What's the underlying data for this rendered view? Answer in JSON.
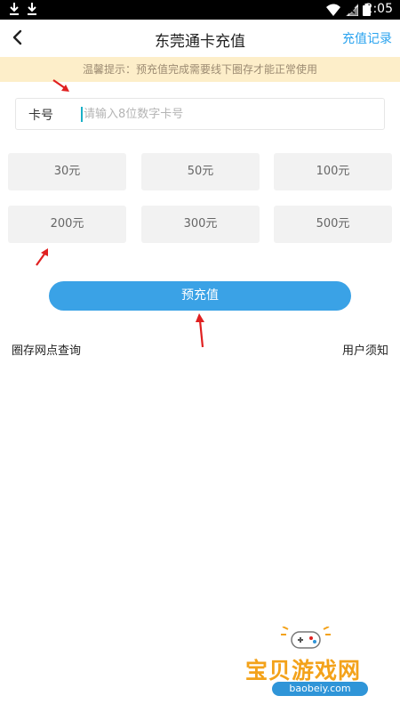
{
  "status_bar": {
    "time": "2:05"
  },
  "header": {
    "title": "东莞通卡充值",
    "records_link": "充值记录"
  },
  "notice": {
    "text": "温馨提示：预充值完成需要线下圈存才能正常使用"
  },
  "card_input": {
    "label": "卡号",
    "placeholder": "请输入8位数字卡号",
    "value": ""
  },
  "amounts": [
    {
      "label": "30元"
    },
    {
      "label": "50元"
    },
    {
      "label": "100元"
    },
    {
      "label": "200元"
    },
    {
      "label": "300元"
    },
    {
      "label": "500元"
    }
  ],
  "submit_button": {
    "label": "预充值"
  },
  "footer_links": {
    "left": "圈存网点查询",
    "right": "用户须知"
  },
  "watermark": {
    "text": "宝贝游戏网",
    "url": "baobeiy.com"
  },
  "colors": {
    "accent": "#3aa2e6",
    "notice_bg": "#fdeec9",
    "arrow": "#e02020"
  }
}
